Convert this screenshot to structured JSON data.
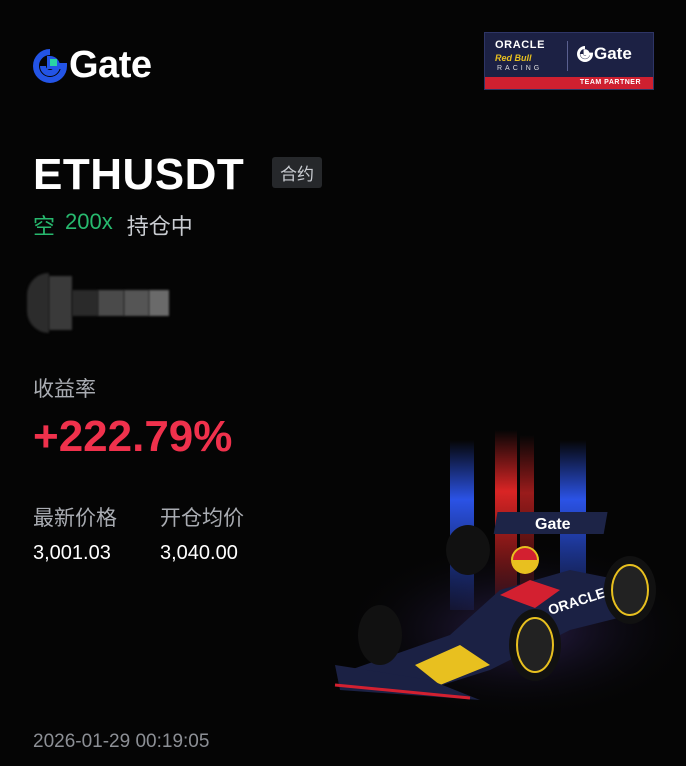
{
  "brand": {
    "name": "Gate",
    "icon": "gate-logo-icon",
    "accent": "#2354e6"
  },
  "partner": {
    "oracle": "ORACLE",
    "team": "Red Bull",
    "racing": "RACING",
    "gate": "Gate",
    "band": "TEAM PARTNER"
  },
  "position": {
    "pair": "ETHUSDT",
    "type_tag": "合约",
    "side": "空",
    "leverage": "200x",
    "status": "持仓中"
  },
  "pnl": {
    "label": "收益率",
    "value": "+222.79%",
    "color": "#f0314c"
  },
  "prices": {
    "last_label": "最新价格",
    "last_value": "3,001.03",
    "entry_label": "开仓均价",
    "entry_value": "3,040.00"
  },
  "timestamp": "2026-01-29 00:19:05",
  "colors": {
    "short": "#27b96e",
    "background": "#050505"
  },
  "illustration": "red-bull-f1-car"
}
